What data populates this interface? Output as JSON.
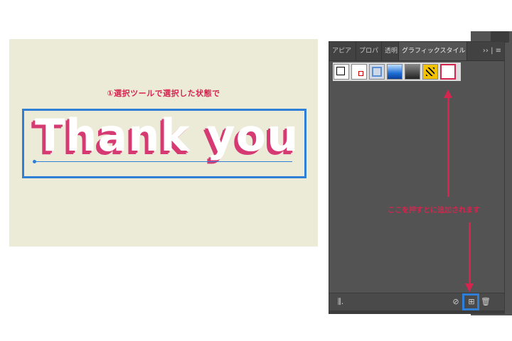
{
  "artboard": {
    "instruction": "①選択ツールで選択した状態で",
    "headline": "Thank you"
  },
  "panel": {
    "tabs": [
      {
        "label": "アピア"
      },
      {
        "label": "プロパ"
      },
      {
        "label": "透明"
      },
      {
        "label": "グラフィックスタイル"
      }
    ],
    "tab_menu": "›› | ≡",
    "swatches": [
      {
        "name": "default"
      },
      {
        "name": "default-no-fill"
      },
      {
        "name": "blue-outline"
      },
      {
        "name": "blue-gradient"
      },
      {
        "name": "black-gradient"
      },
      {
        "name": "yellow-stripe"
      },
      {
        "name": "new-style"
      }
    ],
    "hint": "ここを押すとに追加されます",
    "footer": {
      "library_icon": "libraries-icon",
      "break_link_icon": "break-link-icon",
      "new_style_icon": "new-graphic-style-icon",
      "delete_icon": "trash-icon"
    }
  },
  "colors": {
    "accent": "#d6244f",
    "selection": "#2f7fd6",
    "artboard": "#ecebd8",
    "panel": "#535353"
  }
}
